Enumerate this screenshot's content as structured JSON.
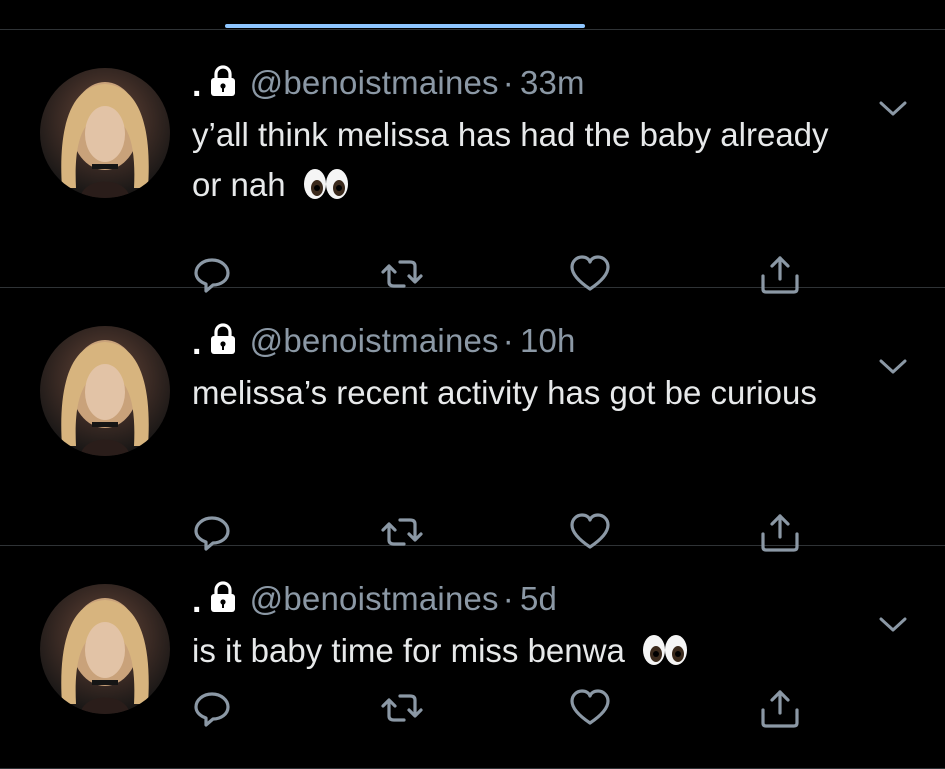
{
  "timeline": {
    "tweets": [
      {
        "display_name": ".",
        "handle": "@benoistmaines",
        "separator": "·",
        "time": "33m",
        "text": "y’all think melissa has had the baby already or nah",
        "has_eyes_emoji": true
      },
      {
        "display_name": ".",
        "handle": "@benoistmaines",
        "separator": "·",
        "time": "10h",
        "text": "melissa’s recent activity has got be curious",
        "has_eyes_emoji": false
      },
      {
        "display_name": ".",
        "handle": "@benoistmaines",
        "separator": "·",
        "time": "5d",
        "text": "is it baby time for miss benwa",
        "has_eyes_emoji": true
      }
    ]
  },
  "icons": {
    "lock": "lock-icon",
    "chevron": "chevron-down-icon",
    "reply": "reply-icon",
    "retweet": "retweet-icon",
    "like": "heart-icon",
    "share": "share-icon",
    "emoji": "eyes-emoji"
  },
  "colors": {
    "background": "#000000",
    "text": "#e7e9ea",
    "muted": "#8b98a5",
    "divider": "#2f3336",
    "tab_indicator": "#8ec6ff"
  }
}
